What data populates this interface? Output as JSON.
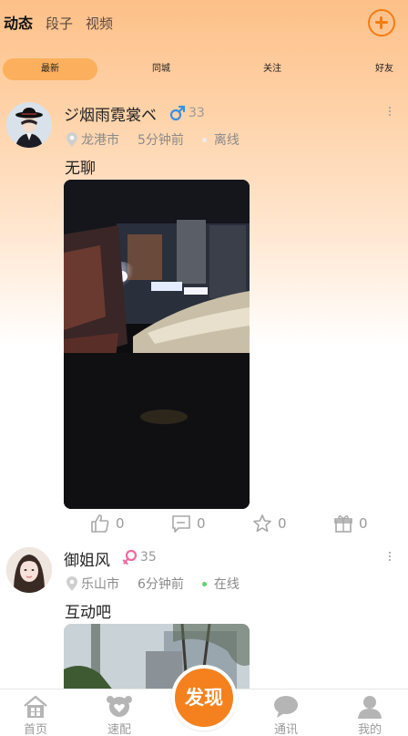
{
  "header": {
    "tabs": [
      {
        "label": "动态",
        "active": true
      },
      {
        "label": "段子",
        "active": false
      },
      {
        "label": "视频",
        "active": false
      }
    ],
    "add_icon": "plus-circle-icon",
    "accent_color": "#f47d13"
  },
  "subtabs": [
    {
      "label": "最新",
      "active": true
    },
    {
      "label": "同城",
      "active": false
    },
    {
      "label": "关注",
      "active": false
    },
    {
      "label": "好友",
      "active": false
    }
  ],
  "posts": [
    {
      "username": "ジ烟雨霓裳ベ",
      "gender": "male",
      "age": "33",
      "location": "龙港市",
      "time": "5分钟前",
      "status": "离线",
      "status_color": "#e0e0e0",
      "caption": "无聊",
      "likes": "0",
      "comments": "0",
      "favorites": "0",
      "gifts": "0"
    },
    {
      "username": "御姐风",
      "gender": "female",
      "age": "35",
      "location": "乐山市",
      "time": "6分钟前",
      "status": "在线",
      "status_color": "#5fd36a",
      "caption": "互动吧"
    }
  ],
  "bottom_nav": {
    "items": [
      {
        "label": "首页",
        "icon": "home-icon"
      },
      {
        "label": "速配",
        "icon": "match-icon"
      },
      {
        "label": "通讯",
        "icon": "chat-icon"
      },
      {
        "label": "我的",
        "icon": "user-icon"
      }
    ],
    "center_button": "发现"
  }
}
